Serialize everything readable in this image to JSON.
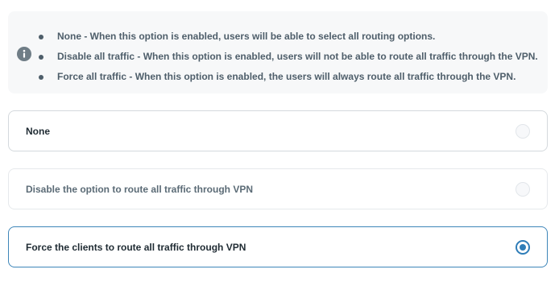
{
  "info": {
    "icon": "info-icon",
    "items": [
      "None - When this option is enabled, users will be able to select all routing options.",
      "Disable all traffic - When this option is enabled, users will not be able to route all traffic through the VPN.",
      "Force all traffic - When this option is enabled, the users will always route all traffic through the VPN."
    ]
  },
  "options": [
    {
      "label": "None",
      "selected": false
    },
    {
      "label": "Disable the option to route all traffic through VPN",
      "selected": false
    },
    {
      "label": "Force the clients to route all traffic through VPN",
      "selected": true
    }
  ],
  "colors": {
    "accent": "#2f7db8",
    "panel_bg": "#f7f8f9",
    "text": "#4e5e6a"
  }
}
